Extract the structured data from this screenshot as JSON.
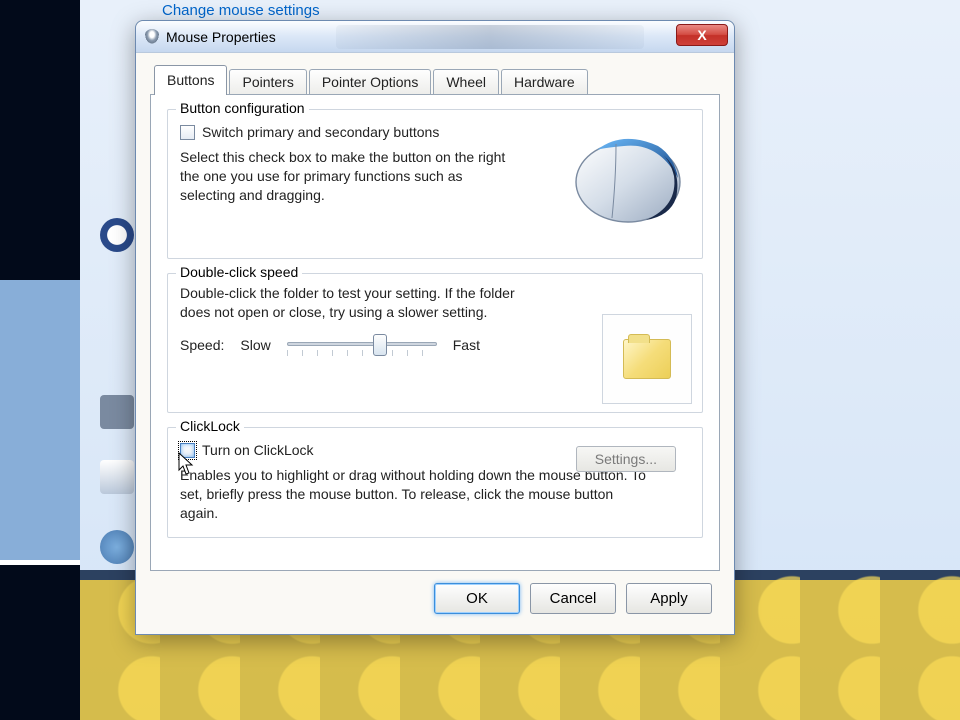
{
  "background": {
    "link": "Change mouse settings"
  },
  "dialog": {
    "title": "Mouse Properties",
    "close_glyph": "X",
    "tabs": [
      "Buttons",
      "Pointers",
      "Pointer Options",
      "Wheel",
      "Hardware"
    ],
    "active_tab": 0,
    "groups": {
      "button_config": {
        "legend": "Button configuration",
        "checkbox_label": "Switch primary and secondary buttons",
        "checkbox_checked": false,
        "description": "Select this check box to make the button on the right the one you use for primary functions such as selecting and dragging."
      },
      "double_click": {
        "legend": "Double-click speed",
        "description": "Double-click the folder to test your setting. If the folder does not open or close, try using a slower setting.",
        "speed_label": "Speed:",
        "slow_label": "Slow",
        "fast_label": "Fast",
        "slider_value_percent": 62
      },
      "clicklock": {
        "legend": "ClickLock",
        "checkbox_label": "Turn on ClickLock",
        "checkbox_checked": false,
        "settings_label": "Settings...",
        "settings_enabled": false,
        "description": "Enables you to highlight or drag without holding down the mouse button. To set, briefly press the mouse button. To release, click the mouse button again."
      }
    },
    "buttons": {
      "ok": "OK",
      "cancel": "Cancel",
      "apply": "Apply"
    }
  }
}
